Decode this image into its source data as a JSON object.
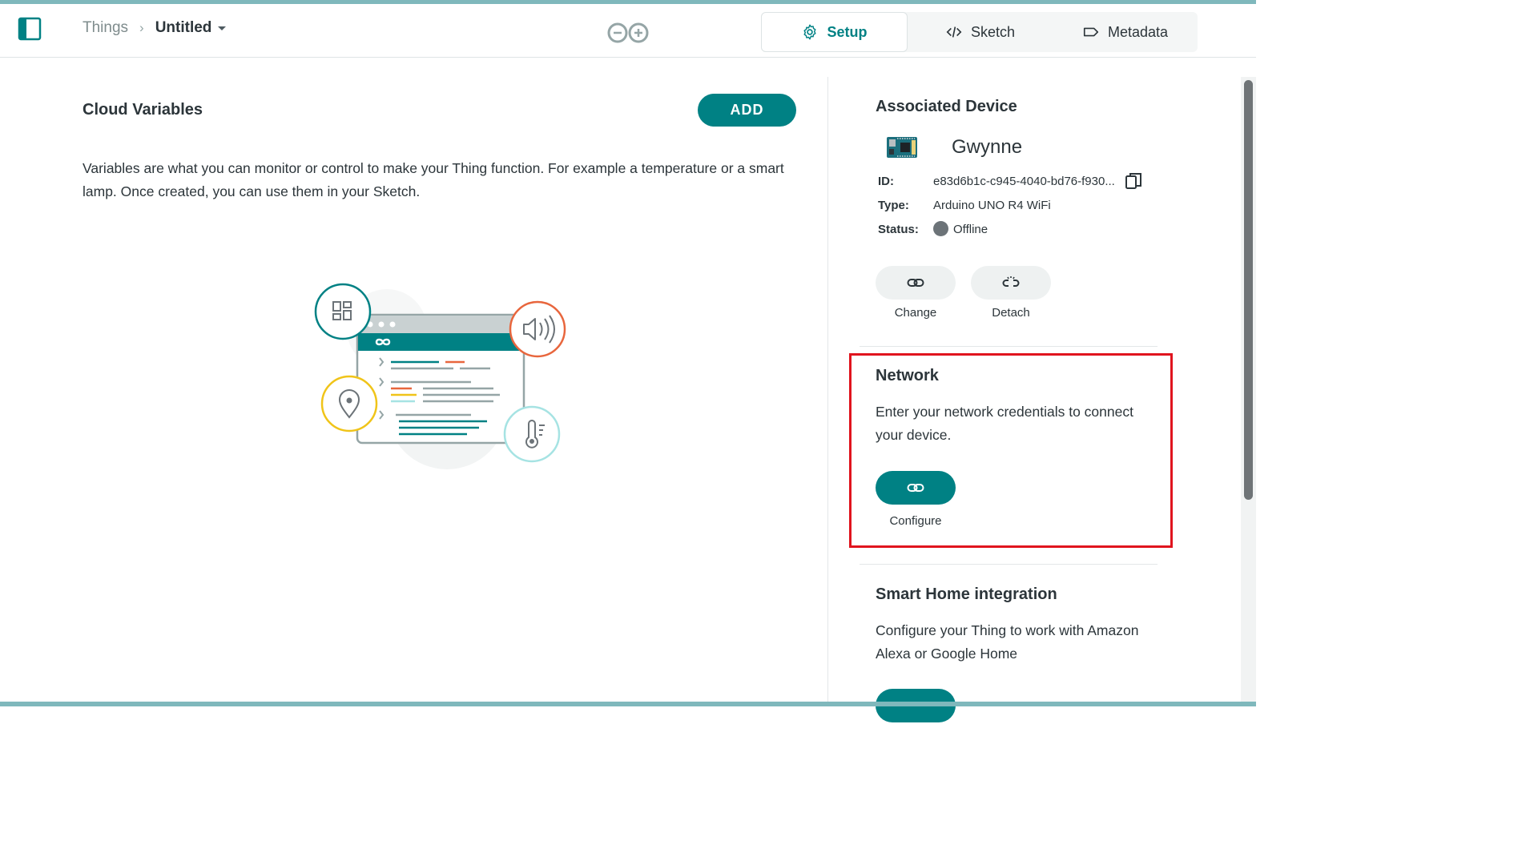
{
  "header": {
    "breadcrumb_root": "Things",
    "breadcrumb_current": "Untitled"
  },
  "tabs": [
    {
      "label": "Setup",
      "icon": "gear-icon",
      "active": true
    },
    {
      "label": "Sketch",
      "icon": "code-icon",
      "active": false
    },
    {
      "label": "Metadata",
      "icon": "tag-icon",
      "active": false
    }
  ],
  "cloud_variables": {
    "title": "Cloud Variables",
    "add_label": "ADD",
    "description": "Variables are what you can monitor or control to make your Thing function. For example a temperature or a smart lamp. Once created, you can use them in your Sketch."
  },
  "associated_device": {
    "title": "Associated Device",
    "name": "Gwynne",
    "id_label": "ID:",
    "id_value": "e83d6b1c-c945-4040-bd76-f930...",
    "type_label": "Type:",
    "type_value": "Arduino UNO R4 WiFi",
    "status_label": "Status:",
    "status_value": "Offline",
    "change_label": "Change",
    "detach_label": "Detach"
  },
  "network": {
    "title": "Network",
    "description": "Enter your network credentials to connect your device.",
    "configure_label": "Configure"
  },
  "smart_home": {
    "title": "Smart Home integration",
    "description": "Configure your Thing to work with Amazon Alexa or Google Home"
  },
  "colors": {
    "accent": "#008184",
    "highlight": "#e0141e",
    "status_offline": "#6c7378"
  }
}
